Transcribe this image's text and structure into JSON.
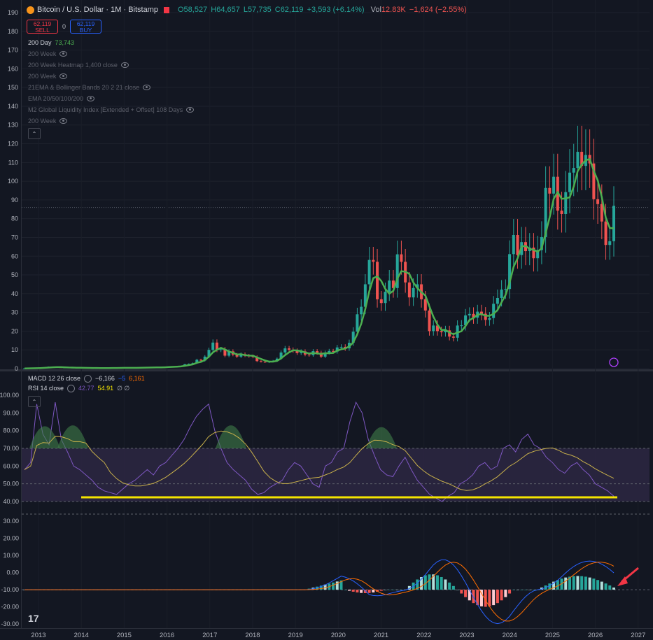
{
  "header": {
    "symbol": "Bitcoin / U.S. Dollar · 1M · Bitstamp",
    "open": "O58,527",
    "high": "H64,657",
    "low": "L57,735",
    "close": "C62,119",
    "change": "+3,593 (+6.14%)",
    "vol_label": "Vol",
    "vol_value": "12.83K",
    "vol_change": "−1,624 (−2.55%)"
  },
  "trade": {
    "sell_price": "62,119",
    "sell_label": "SELL",
    "spread": "0",
    "buy_price": "62,119",
    "buy_label": "BUY"
  },
  "indicators": [
    {
      "label": "200 Day",
      "value": "73,743"
    },
    {
      "label": "200 Week"
    },
    {
      "label": "200 Week Heatmap 1,400 close"
    },
    {
      "label": "200 Week"
    },
    {
      "label": "21EMA & Bollinger Bands 20 2 21 close"
    },
    {
      "label": "EMA 20/50/100/200"
    },
    {
      "label": "M2 Global Liquidity Index [Extended + Offset] 108 Days"
    },
    {
      "label": "200 Week"
    }
  ],
  "collapse_glyph": "⌃",
  "price_axis": [
    "190",
    "180",
    "170",
    "160",
    "150",
    "140",
    "130",
    "120",
    "110",
    "100",
    "90",
    "80",
    "70",
    "60",
    "50",
    "40",
    "30",
    "20",
    "10",
    "0"
  ],
  "lower_pane": {
    "macd_label": "MACD 12 26 close",
    "macd_v1": "−6,166",
    "macd_v2": "−5",
    "macd_v3": "6,161",
    "rsi_label": "RSI 14 close",
    "rsi_v1": "42.77",
    "rsi_v2": "54.91",
    "rsi_na": "∅ ∅",
    "rsi_axis": [
      "100.00",
      "90.00",
      "80.00",
      "70.00",
      "60.00",
      "50.00",
      "40.00"
    ],
    "macd_axis": [
      "30.00",
      "20.00",
      "10.00",
      "0.00",
      "-10.00",
      "-20.00",
      "-30.00"
    ]
  },
  "time_axis": [
    "2013",
    "2014",
    "2015",
    "2016",
    "2017",
    "2018",
    "2019",
    "2020",
    "2021",
    "2022",
    "2023",
    "2024",
    "2025",
    "2026",
    "2027"
  ],
  "logo": "17",
  "colors": {
    "up": "#26a69a",
    "down": "#ef5350",
    "ma": "#4caf50",
    "rsi": "#7e57c2",
    "rsi_ma": "#c9b14b",
    "macd": "#2962ff",
    "signal": "#ff6d00",
    "support": "#f5e400",
    "arrow": "#f23645"
  }
}
